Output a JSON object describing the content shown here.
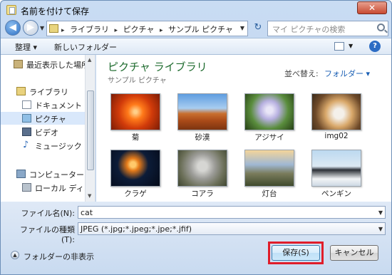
{
  "window": {
    "title": "名前を付けて保存",
    "close_label": "✕"
  },
  "nav": {
    "back_icon": "◀",
    "forward_icon": "▶"
  },
  "address": {
    "crumbs": [
      "ライブラリ",
      "ピクチャ",
      "サンプル ピクチャ"
    ],
    "separator": "▸"
  },
  "search": {
    "placeholder": "マイ ピクチャの検索"
  },
  "toolbar": {
    "organize_label": "整理 ▾",
    "new_folder_label": "新しいフォルダー",
    "help_label": "?"
  },
  "sidebar": {
    "items": [
      {
        "label": "最近表示した場所",
        "icon": "recent-places-icon"
      },
      {
        "label": "ライブラリ",
        "icon": "library-icon"
      },
      {
        "label": "ドキュメント",
        "icon": "documents-icon"
      },
      {
        "label": "ピクチャ",
        "icon": "pictures-icon",
        "selected": true
      },
      {
        "label": "ビデオ",
        "icon": "videos-icon"
      },
      {
        "label": "ミュージック",
        "icon": "music-icon"
      },
      {
        "label": "コンピューター",
        "icon": "computer-icon"
      },
      {
        "label": "ローカル ディスク",
        "icon": "local-disk-icon"
      }
    ]
  },
  "library": {
    "title": "ピクチャ ライブラリ",
    "subtitle": "サンプル ピクチャ",
    "sort_label": "並べ替え:",
    "sort_value": "フォルダー ▾"
  },
  "thumbnails": [
    {
      "label": "菊"
    },
    {
      "label": "砂漠"
    },
    {
      "label": "アジサイ"
    },
    {
      "label": "img02"
    },
    {
      "label": "クラゲ"
    },
    {
      "label": "コアラ"
    },
    {
      "label": "灯台"
    },
    {
      "label": "ペンギン"
    }
  ],
  "form": {
    "filename_label": "ファイル名(N):",
    "filename_value": "cat",
    "filetype_label": "ファイルの種類(T):",
    "filetype_value": "JPEG (*.jpg;*.jpeg;*.jpe;*.jfif)"
  },
  "footer": {
    "hide_folders_label": "フォルダーの非表示",
    "save_label": "保存(S)",
    "cancel_label": "キャンセル"
  },
  "colors": {
    "highlight_border": "#e01d2a",
    "library_title": "#1e6b2e",
    "link_blue": "#1a5fb4"
  }
}
